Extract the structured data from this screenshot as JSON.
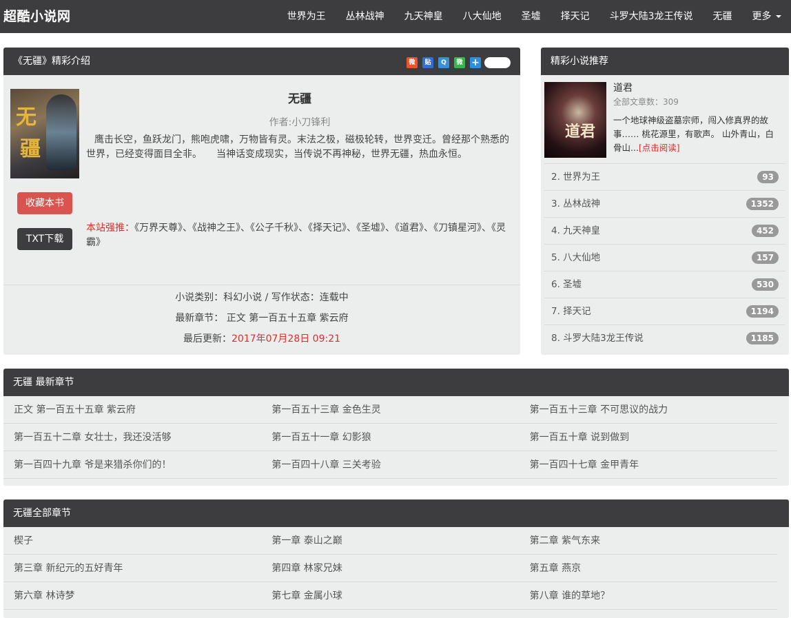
{
  "nav": {
    "brand": "超酷小说网",
    "links": [
      "世界为王",
      "丛林战神",
      "九天神皇",
      "八大仙地",
      "圣墟",
      "择天记",
      "斗罗大陆3龙王传说",
      "无疆"
    ],
    "more": "更多"
  },
  "intro": {
    "header": "《无疆》精彩介绍",
    "share_icons": [
      "weibo-icon",
      "tieba-icon",
      "qq-icon",
      "wechat-icon",
      "more-share-icon"
    ],
    "title": "无疆",
    "author": "作者:小刀锋利",
    "description": "鹰击长空，鱼跃龙门，熊咆虎啸，万物皆有灵。末法之极，磁极轮转，世界变迁。曾经那个熟悉的世界，已经变得面目全非。　　当神话变成现实，当传说不再神秘，世界无疆，热血永恒。",
    "cover_text": [
      "无",
      "疆"
    ],
    "fav_button": "收藏本书",
    "txt_button": "TXT下载",
    "recommend_label": "本站强推：",
    "recommend_text": "《万界天尊》、《战神之王》、《公子千秋》、《择天记》、《圣墟》、《道君》、《刀镇星河》、《灵霸》",
    "category_line": "小说类别：科幻小说 / 写作状态：连载中",
    "latest_label": "最新章节：",
    "latest_value": "正文 第一百五十五章 紫云府",
    "update_label": "最后更新：",
    "update_value": "2017年07月28日 09:21"
  },
  "side": {
    "header": "精彩小说推荐",
    "featured": {
      "title": "道君",
      "count": "全部文章数：309",
      "desc": "一个地球神级盗墓宗师，闯入修真界的故事…… 桃花源里，有歌声。 山外青山，白骨山...",
      "read_more": "[点击阅读]",
      "cover_text": "道君"
    },
    "items": [
      {
        "label": "2. 世界为王",
        "count": "93"
      },
      {
        "label": "3. 丛林战神",
        "count": "1352"
      },
      {
        "label": "4. 九天神皇",
        "count": "452"
      },
      {
        "label": "5. 八大仙地",
        "count": "157"
      },
      {
        "label": "6. 圣墟",
        "count": "530"
      },
      {
        "label": "7. 择天记",
        "count": "1194"
      },
      {
        "label": "8. 斗罗大陆3龙王传说",
        "count": "1185"
      }
    ]
  },
  "latest": {
    "header": "无疆 最新章节",
    "chapters": [
      "正文 第一百五十五章 紫云府",
      "第一百五十三章 金色生灵",
      "第一百五十三章 不可思议的战力",
      "第一百五十二章 女壮士，我还没活够",
      "第一百五十一章 幻影狼",
      "第一百五十章 说到做到",
      "第一百四十九章 爷是来猎杀你们的！",
      "第一百四十八章 三关考验",
      "第一百四十七章 金甲青年"
    ]
  },
  "all": {
    "header": "无疆全部章节",
    "chapters": [
      "楔子",
      "第一章 泰山之巅",
      "第二章 紫气东来",
      "第三章 新纪元的五好青年",
      "第四章 林家兄妹",
      "第五章 燕京",
      "第六章 林诗梦",
      "第七章 金属小球",
      "第八章 谁的草地？"
    ]
  },
  "colors": {
    "nav_bg": "#3d3d40",
    "panel_bg": "#eceeee",
    "accent_red": "#d9534f",
    "link_red": "#d9302a",
    "badge": "#999999"
  }
}
